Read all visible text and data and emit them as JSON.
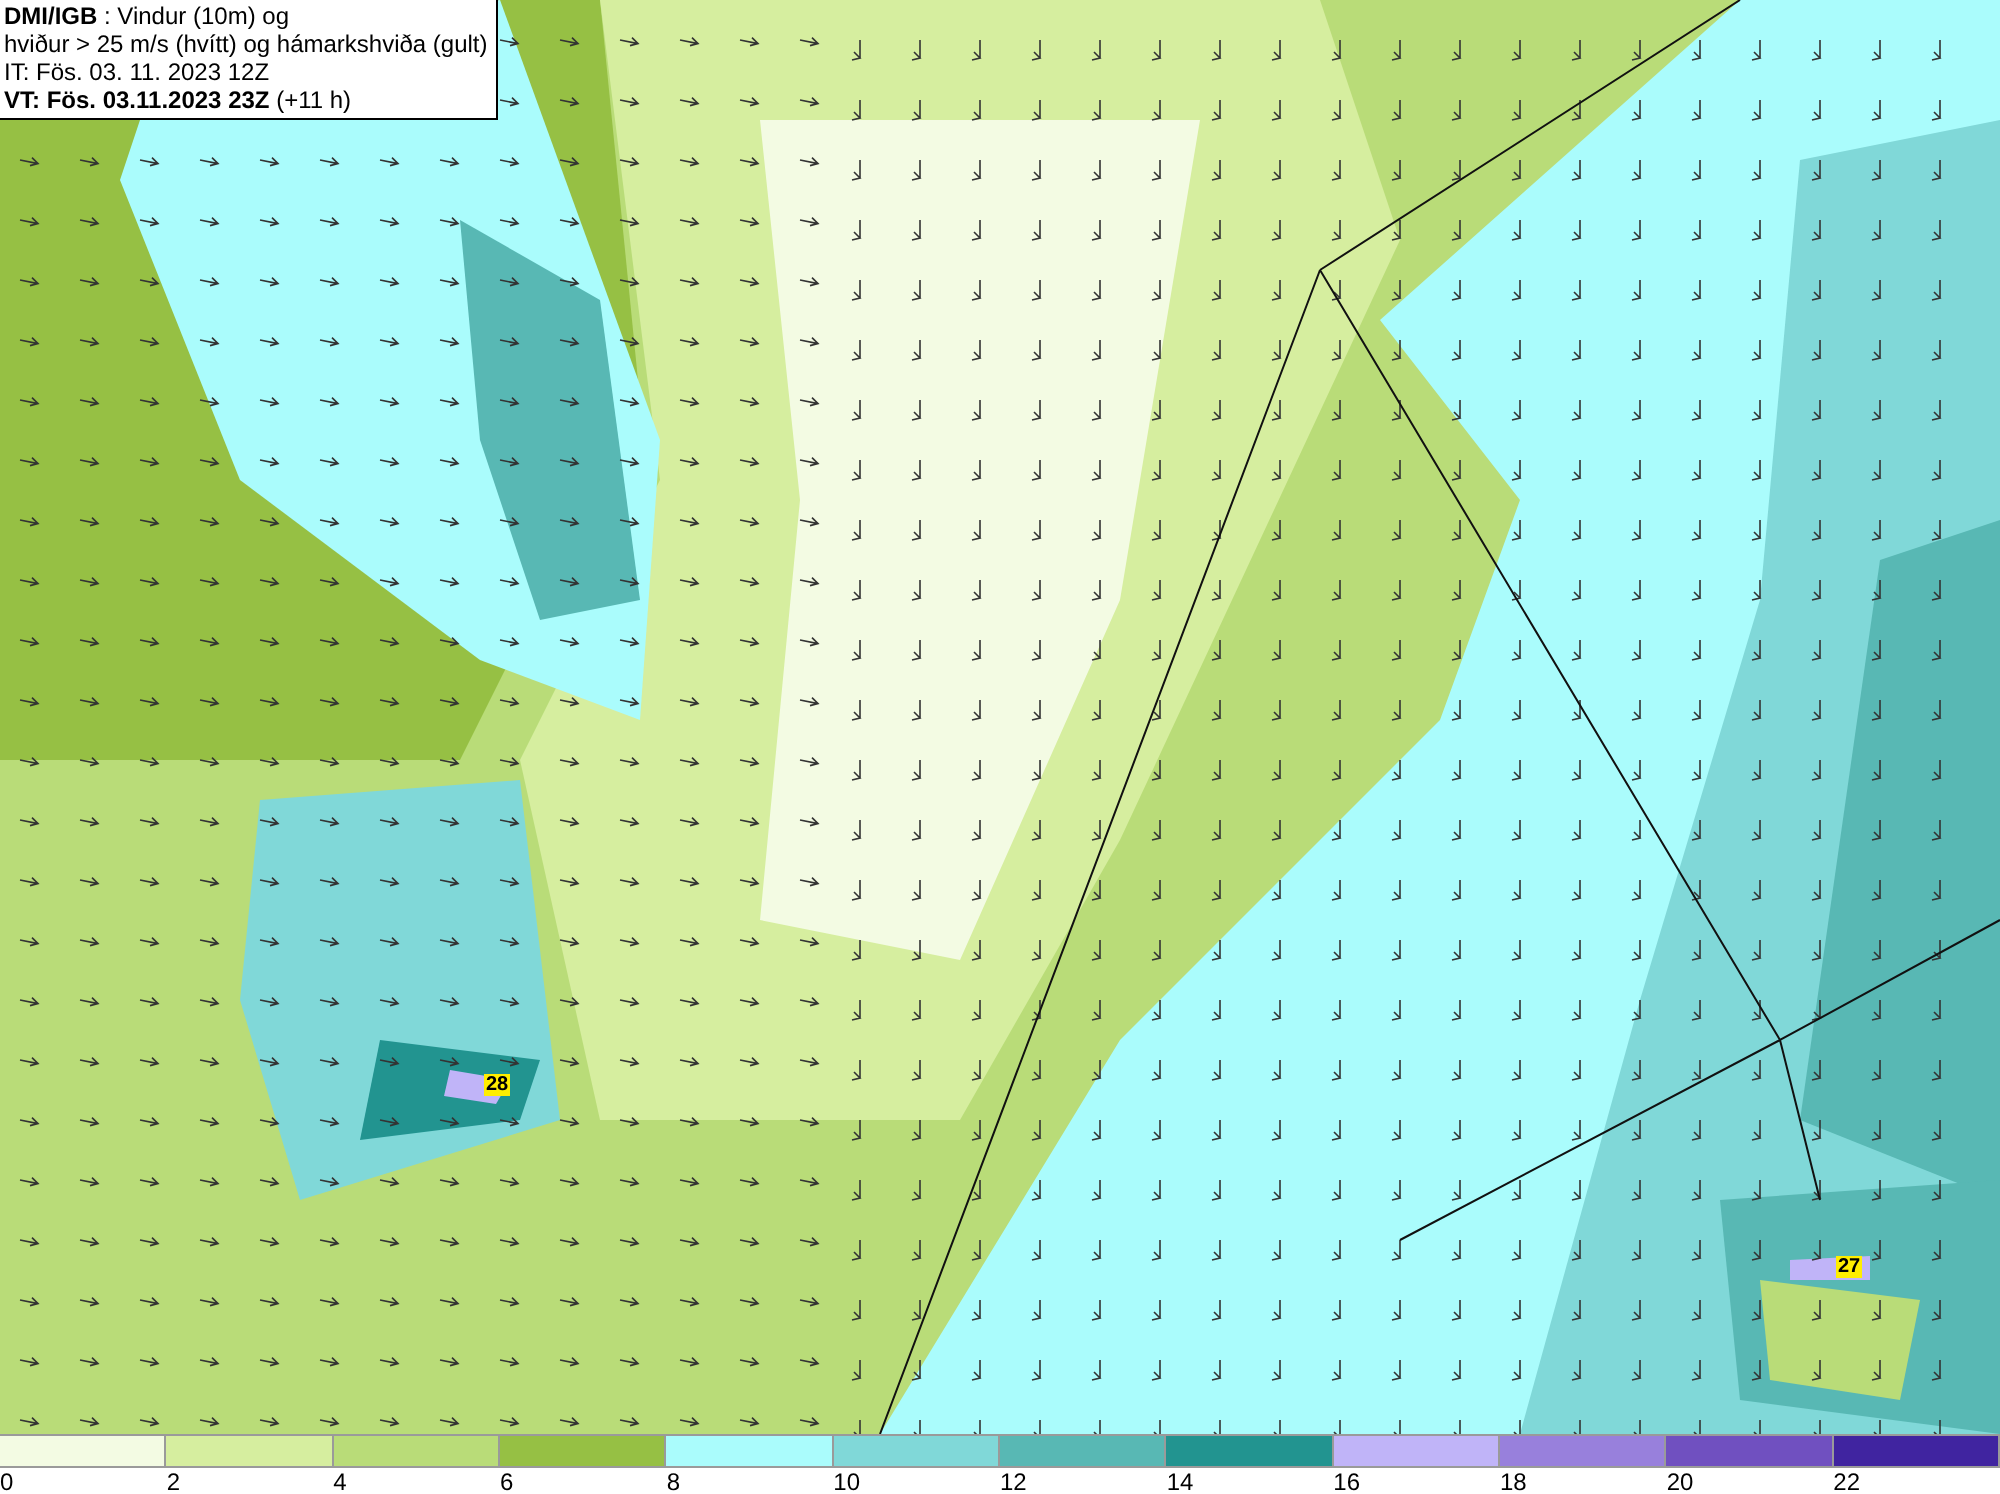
{
  "title_box": {
    "lines": [
      "**DMI/IGB** : Vindur (10m) og",
      "hviður > 25 m/s (hvítt) og hámarkshviða (gult)",
      "IT: Fös. 03. 11. 2023 12Z",
      "**VT: Fös. 03.11.2023 23Z** (+11 h)"
    ]
  },
  "map": {
    "gust_labels": [
      {
        "text": "28"
      },
      {
        "text": "27"
      }
    ]
  },
  "legend": {
    "segments": [
      {
        "label": "0",
        "color": "#f3fbe3"
      },
      {
        "label": "2",
        "color": "#d6ee9f"
      },
      {
        "label": "4",
        "color": "#b9dc78"
      },
      {
        "label": "6",
        "color": "#96c044"
      },
      {
        "label": "8",
        "color": "#aafcfc"
      },
      {
        "label": "10",
        "color": "#80d8d8"
      },
      {
        "label": "12",
        "color": "#58b8b4"
      },
      {
        "label": "14",
        "color": "#229490"
      },
      {
        "label": "16",
        "color": "#c0b4f8"
      },
      {
        "label": "18",
        "color": "#9880dc"
      },
      {
        "label": "20",
        "color": "#7050c0"
      },
      {
        "label": "22",
        "color": "#4024a0"
      }
    ]
  }
}
